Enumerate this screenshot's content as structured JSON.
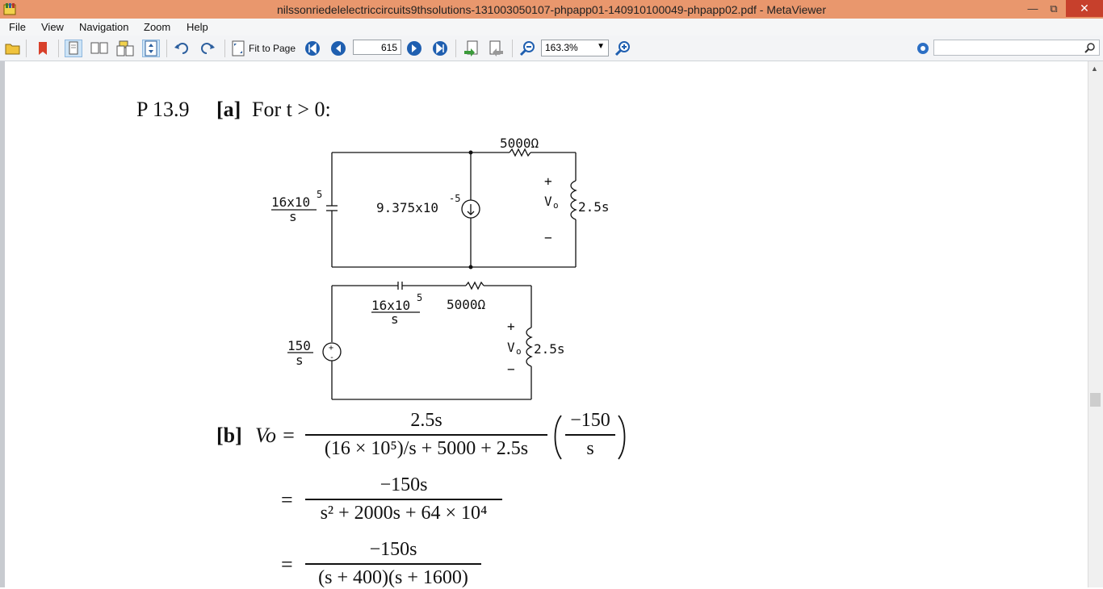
{
  "window": {
    "title": "nilssonriedelelectriccircuits9thsolutions-131003050107-phpapp01-140910100049-phpapp02.pdf - MetaViewer"
  },
  "menu": [
    "File",
    "View",
    "Navigation",
    "Zoom",
    "Help"
  ],
  "toolbar": {
    "fit_label": "Fit to Page",
    "page_value": "615",
    "zoom_value": "163.3%",
    "icons": [
      "open-folder-icon",
      "bookmark-icon",
      "single-page-icon",
      "two-page-icon",
      "continuous-page-icon",
      "fit-width-icon",
      "rotate-ccw-icon",
      "rotate-cw-icon",
      "fit-page-icon",
      "first-page-icon",
      "prev-page-icon",
      "next-page-icon",
      "last-page-icon",
      "back-icon",
      "forward-icon",
      "zoom-out-icon",
      "zoom-in-icon",
      "settings-icon",
      "search-icon"
    ]
  },
  "doc": {
    "problem": "P 13.9",
    "part_a": "[a]",
    "for_t": "For t > 0:",
    "c1": {
      "r_label": "5000Ω",
      "cap_num": "16x10",
      "cap_exp": "5",
      "cap_den": "s",
      "src_label": "9.375x10",
      "src_exp": "-5",
      "plus": "+",
      "vo": "V",
      "vo_sub": "o",
      "minus": "−",
      "ind_label": "2.5s"
    },
    "c2": {
      "cap_num": "16x10",
      "cap_exp": "5",
      "cap_den": "s",
      "r_label": "5000Ω",
      "src_num": "150",
      "src_den": "s",
      "plus": "+",
      "vo": "V",
      "vo_sub": "o",
      "minus": "−",
      "ind_label": "2.5s"
    },
    "part_b": "[b]",
    "eq1_lhs": "Vo =",
    "eq1_num": "2.5s",
    "eq1_den": "(16 × 10⁵)/s + 5000 + 2.5s",
    "eq1_paren_num": "−150",
    "eq1_paren_den": "s",
    "eq2_eq": "=",
    "eq2_num": "−150s",
    "eq2_den": "s² + 2000s + 64 × 10⁴",
    "eq3_eq": "=",
    "eq3_num": "−150s",
    "eq3_den": "(s + 400)(s + 1600)"
  },
  "colors": {
    "titlebar": "#e9976d",
    "close": "#c7402c",
    "toolbar_bg": "#f3f4f6"
  }
}
